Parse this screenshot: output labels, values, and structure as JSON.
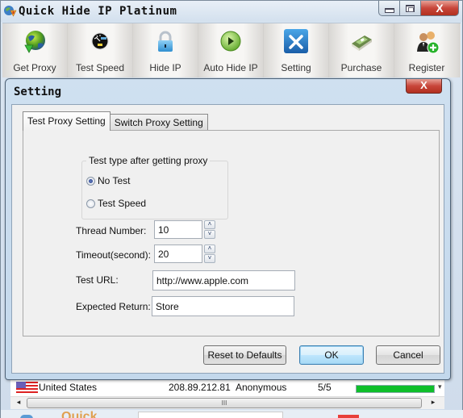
{
  "window": {
    "title": "Quick Hide IP Platinum",
    "controls": {
      "minimize": "minimize",
      "maximize": "maximize",
      "close": "X"
    }
  },
  "toolbar": [
    {
      "label": "Get Proxy",
      "icon": "globe-download-icon"
    },
    {
      "label": "Test Speed",
      "icon": "speedometer-icon"
    },
    {
      "label": "Hide IP",
      "icon": "padlock-icon"
    },
    {
      "label": "Auto Hide IP",
      "icon": "play-icon"
    },
    {
      "label": "Setting",
      "icon": "tools-icon"
    },
    {
      "label": "Purchase",
      "icon": "money-icon"
    },
    {
      "label": "Register",
      "icon": "users-add-icon"
    }
  ],
  "dialog": {
    "title": "Setting",
    "close_label": "X",
    "tabs": [
      {
        "label": "Test Proxy Setting",
        "active": true
      },
      {
        "label": "Switch Proxy Setting",
        "active": false
      }
    ],
    "test_type": {
      "legend": "Test type after getting proxy",
      "options": [
        {
          "label": "No Test",
          "selected": true
        },
        {
          "label": "Test Speed",
          "selected": false
        }
      ]
    },
    "fields": {
      "thread_number": {
        "label": "Thread Number:",
        "value": "10"
      },
      "timeout": {
        "label": "Timeout(second):",
        "value": "20"
      },
      "test_url": {
        "label": "Test URL:",
        "value": "http://www.apple.com"
      },
      "expected_return": {
        "label": "Expected Return:",
        "value": "Store"
      }
    },
    "spin_up": "˄",
    "spin_down": "˅",
    "buttons": {
      "reset": "Reset to Defaults",
      "ok": "OK",
      "cancel": "Cancel"
    }
  },
  "proxy_list": {
    "rows": [
      {
        "country": "United States",
        "flag": "us-flag-icon",
        "ip": "208.89.212.81",
        "type": "Anonymous",
        "score": "5/5",
        "speed_fraction": 1.0
      }
    ],
    "scroll_left": "◂",
    "scroll_right": "▸",
    "scroll_grip": "III",
    "dropdown_arrow": "▾"
  },
  "footer": {
    "logo_text": "Quick"
  },
  "colors": {
    "accent_blue": "#3c7fb1",
    "close_red": "#c8463a",
    "speed_green": "#0fbf2a"
  }
}
